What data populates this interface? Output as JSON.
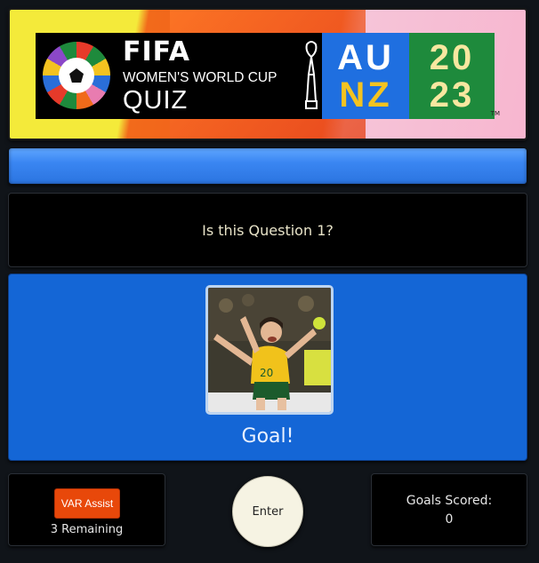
{
  "banner": {
    "brand": "FIFA",
    "subtitle": "WOMEN'S WORLD CUP",
    "title": "QUIZ",
    "host_top": "AU",
    "host_bottom": "NZ",
    "year_top": "20",
    "year_bottom": "23",
    "trademark": "TM"
  },
  "progress": {
    "fraction": 0.0
  },
  "question": {
    "text": "Is this Question 1?"
  },
  "answer": {
    "image_icon": "celebrating-player-photo",
    "label": "Goal!"
  },
  "var_assist": {
    "button_label": "VAR Assist",
    "remaining": "3 Remaining"
  },
  "enter": {
    "label": "Enter"
  },
  "goals": {
    "label": "Goals Scored:",
    "value": "0"
  },
  "colors": {
    "answer_bg": "#1466d6",
    "var_button": "#e8480a",
    "progress": "#3a86f2",
    "enter_bg": "#f6f3e3"
  }
}
